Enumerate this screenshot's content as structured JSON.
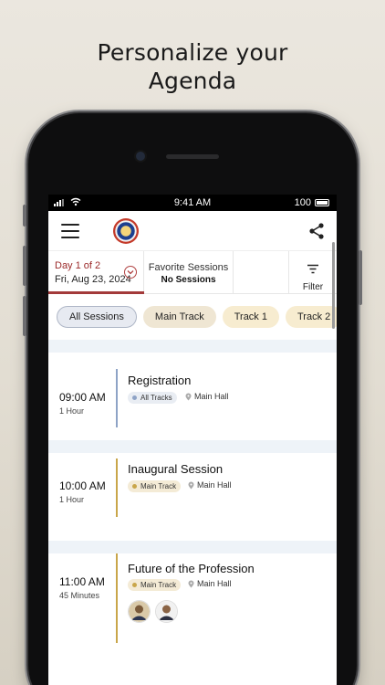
{
  "headline": {
    "line1": "Personalize your",
    "line2": "Agenda"
  },
  "status_bar": {
    "time": "9:41 AM",
    "battery": "100"
  },
  "app_bar": {
    "menu_icon": "hamburger-menu-icon",
    "logo_icon": "institute-logo",
    "share_icon": "share-icon"
  },
  "tabs": {
    "day": {
      "label": "Day 1 of 2",
      "date": "Fri, Aug 23, 2024"
    },
    "favorites": {
      "label": "Favorite Sessions",
      "value": "No Sessions"
    },
    "filter": {
      "label": "Filter"
    }
  },
  "chips": [
    "All Sessions",
    "Main Track",
    "Track 1",
    "Track 2"
  ],
  "sessions": [
    {
      "time": "09:00 AM",
      "duration": "1 Hour",
      "title": "Registration",
      "tag": "All Tracks",
      "location": "Main Hall"
    },
    {
      "time": "10:00 AM",
      "duration": "1 Hour",
      "title": "Inaugural Session",
      "tag": "Main Track",
      "location": "Main Hall"
    },
    {
      "time": "11:00 AM",
      "duration": "45 Minutes",
      "title": "Future of the Profession",
      "tag": "Main Track",
      "location": "Main Hall"
    }
  ],
  "colors": {
    "accent": "#a33a3a",
    "all_tracks": "#8ea3c6",
    "main_track": "#c9a64a"
  }
}
